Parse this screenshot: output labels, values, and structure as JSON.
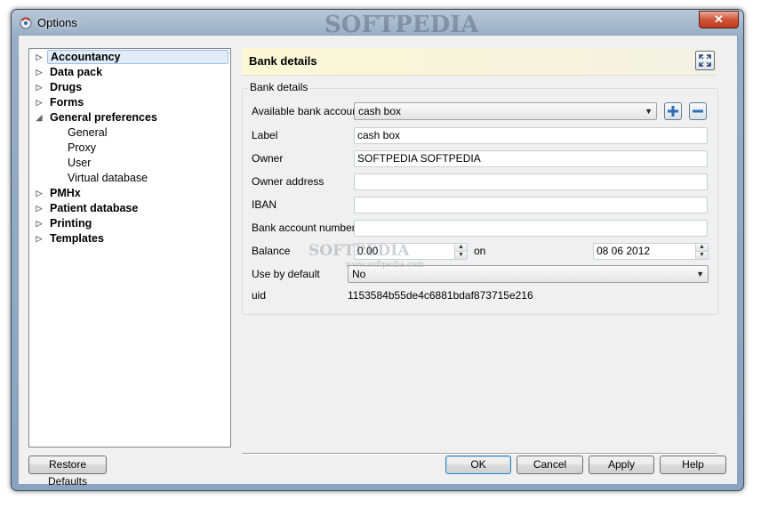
{
  "window": {
    "title": "Options",
    "close_label": "✕"
  },
  "watermark": {
    "top": "SOFTPEDIA",
    "middle": "SOFTPEDIA",
    "sub": "www.softpedia.com"
  },
  "tree": {
    "items": [
      {
        "label": "Accountancy",
        "level": 0,
        "arrow": "▷",
        "bold": true,
        "selected": true
      },
      {
        "label": "Data pack",
        "level": 0,
        "arrow": "▷",
        "bold": true
      },
      {
        "label": "Drugs",
        "level": 0,
        "arrow": "▷",
        "bold": true
      },
      {
        "label": "Forms",
        "level": 0,
        "arrow": "▷",
        "bold": true
      },
      {
        "label": "General preferences",
        "level": 0,
        "arrow": "◢",
        "bold": true
      },
      {
        "label": "General",
        "level": 1,
        "arrow": "",
        "bold": false
      },
      {
        "label": "Proxy",
        "level": 1,
        "arrow": "",
        "bold": false
      },
      {
        "label": "User",
        "level": 1,
        "arrow": "",
        "bold": false
      },
      {
        "label": "Virtual database",
        "level": 1,
        "arrow": "",
        "bold": false
      },
      {
        "label": "PMHx",
        "level": 0,
        "arrow": "▷",
        "bold": true
      },
      {
        "label": "Patient database",
        "level": 0,
        "arrow": "▷",
        "bold": true
      },
      {
        "label": "Printing",
        "level": 0,
        "arrow": "▷",
        "bold": true
      },
      {
        "label": "Templates",
        "level": 0,
        "arrow": "▷",
        "bold": true
      }
    ]
  },
  "panel": {
    "title": "Bank details",
    "group_title": "Bank details",
    "fields": {
      "available_account": {
        "label": "Available bank account",
        "value": "cash box"
      },
      "label": {
        "label": "Label",
        "value": "cash box"
      },
      "owner": {
        "label": "Owner",
        "value": "SOFTPEDIA SOFTPEDIA"
      },
      "owner_address": {
        "label": "Owner address",
        "value": ""
      },
      "iban": {
        "label": "IBAN",
        "value": ""
      },
      "account_number": {
        "label": "Bank account number",
        "value": ""
      },
      "balance": {
        "label": "Balance",
        "value": "0.00",
        "on_label": "on",
        "date": "08 06 2012"
      },
      "use_by_default": {
        "label": "Use by default",
        "value": "No"
      },
      "uid": {
        "label": "uid",
        "value": "1153584b55de4c6881bdaf873715e216"
      }
    }
  },
  "buttons": {
    "restore_defaults": "Restore Defaults",
    "ok": "OK",
    "cancel": "Cancel",
    "apply": "Apply",
    "help": "Help"
  },
  "colors": {
    "accent": "#3c7fb1",
    "header_bg": "#fcf8d6",
    "selection": "#e1ecf8"
  }
}
